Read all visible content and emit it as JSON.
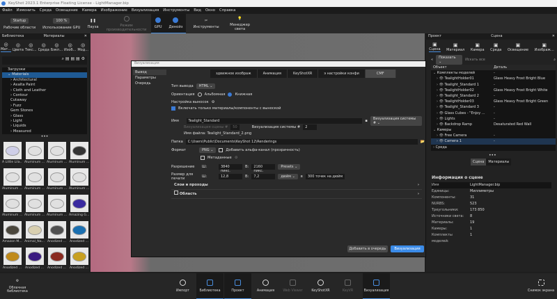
{
  "title": "KeyShot 2023.1 Enterprise Floating License - LightManager.bip",
  "menu": [
    "Файл",
    "Изменить",
    "Среда",
    "Освещение",
    "Камера",
    "Изображение",
    "Визуализация",
    "Инструменты",
    "Вид",
    "Окно",
    "Справка"
  ],
  "toolbar": {
    "workspace_value": "Startup",
    "workspace_label": "Рабочие области",
    "gpu_value": "100 %",
    "gpu_label": "Использование GPU",
    "pause": "Пауза",
    "perf": "Режим производительности",
    "gpu": "GPU",
    "denoise": "Денойз",
    "tools": "Инструменты",
    "light_manager": "Менеджер света"
  },
  "left": {
    "header_left": "Библиотека",
    "header_center": "Материалы",
    "tabs": [
      "Мат...",
      "Цвета",
      "Текс...",
      "Среда",
      "Бэкп...",
      "Изоб...",
      "Мод..."
    ],
    "tree": [
      "Загрузки",
      "Materials",
      "Architectural",
      "Axalta Paint",
      "Cloth and Leather",
      "Contour",
      "Cutaway",
      "Fuzz",
      "Gem Stones",
      "Glass",
      "Light",
      "Liquids",
      "Measured"
    ],
    "thumbs": [
      "A Little Lila...",
      "Aluminum ...",
      "Aluminum ...",
      "Aluminum ...",
      "Aluminum ...",
      "Aluminum ...",
      "Aluminum ...",
      "Aluminum ...",
      "Aluminum ...",
      "Aluminum ...",
      "Aluminum ...",
      "Amazing G...",
      "Amazon M...",
      "Animal_Na...",
      "Anodized ...",
      "Anodized ...",
      "Anodized ...",
      "Anodized ...",
      "Anodized ...",
      "Anodized ..."
    ],
    "thumb_colors": [
      "#cfcfe8",
      "#e0e0e0",
      "#e0e0e0",
      "#333333",
      "#e0e0e0",
      "#e0e0e0",
      "#e0e0e0",
      "#e0e0e0",
      "#e0e0e0",
      "#e0e0e0",
      "#e0e0e0",
      "#3a2aa0",
      "#4a463c",
      "#d8cfb0",
      "#505050",
      "#1a6fb0",
      "#c08a1a",
      "#3a1a80",
      "#8a2a20",
      "#c8a020"
    ]
  },
  "dialog": {
    "title": "Визуализация",
    "nav": [
      "Вывод",
      "Параметры",
      "Очередь"
    ],
    "tabs": [
      "здвижное изображ",
      "Анимация",
      "KeyShotXR",
      "э настройки конфи",
      "CMF"
    ],
    "output_type_label": "Тип вывода",
    "output_type": "HTML",
    "orientation_label": "Ориентация",
    "landscape": "Альбомная",
    "portrait": "Книжная",
    "callout_label": "Настройка выносок",
    "include_only": "Включать только материалы/компоненты с выноской",
    "name_label": "Имя",
    "name_value": "Tealight_Standard",
    "suffix": "Визуализация системы #",
    "scene_render_label": "Визуализация сцены #",
    "scene_render_value": "50",
    "system_render_label": "Визуализация системы #",
    "system_render_value": "2",
    "filename": "Имя файла: Tealight_Standard_2.png",
    "folder_label": "Папка",
    "folder": "C:\\Users\\Public\\Documents\\KeyShot 12\\Renderings",
    "format_label": "Формат",
    "format": "PNG",
    "alpha": "Добавить альфа-канал (прозрачность)",
    "metadata": "Метаданные",
    "resolution_label": "Разрешение",
    "w": "Ш:",
    "h": "В:",
    "res_w": "3840 пикс.",
    "res_h": "2160 пикс.",
    "presets": "Presets",
    "print_label": "Размер для печати",
    "print_w": "12,8",
    "print_h": "7,2",
    "unit": "дюйм",
    "at": "в",
    "dpi": "300 точек на дюйм",
    "layers": "Слои и проходы",
    "region": "Область",
    "queue_btn": "Добавить в очередь",
    "render_btn": "Визуализация"
  },
  "right": {
    "header_left": "Проект",
    "header_center": "Сцена",
    "tabs": [
      "Сцена",
      "Материал",
      "Камера",
      "Среда",
      "Освещение",
      "Изображ..."
    ],
    "show": "Показать",
    "search_placeholder": "Искать все",
    "col_object": "Объект",
    "col_detail": "Деталь",
    "rows": [
      [
        "Комплекты моделей",
        "-"
      ],
      [
        "TealightHolder01",
        "Glass Heavy Frost Bright Blue"
      ],
      [
        "Tealight_Standard 1",
        "-"
      ],
      [
        "TealightHolder02",
        "Glass Heavy Frost Bright White"
      ],
      [
        "Tealight_Standard 2",
        "-"
      ],
      [
        "TealightHolder03",
        "Glass Heavy Frost Bright Green"
      ],
      [
        "Tealight_Standard 3",
        "-"
      ],
      [
        "Glass Cubes - \"Enjoy ...",
        "-"
      ],
      [
        "Lights",
        "-"
      ],
      [
        "Backdrop Ramp",
        "Desaturated Red Wall"
      ],
      [
        "Камеры",
        ""
      ],
      [
        "Free Camera",
        "-"
      ],
      [
        "Camera 1",
        "-"
      ],
      [
        "Среда",
        ""
      ]
    ],
    "bottom_tabs": [
      "Сцена",
      "Материалы"
    ],
    "info_title": "Информация о сцене",
    "info": [
      [
        "Имя",
        "LightManager.bip"
      ],
      [
        "Единицы:",
        "Миллиметры"
      ],
      [
        "Компоненты:",
        "31"
      ],
      [
        "NURBS:",
        "523"
      ],
      [
        "Треугольники:",
        "173 850"
      ],
      [
        "Источники света:",
        "8"
      ],
      [
        "Материалы:",
        "19"
      ],
      [
        "Камеры:",
        "1"
      ],
      [
        "Комплекты моделей:",
        "1"
      ]
    ]
  },
  "bottom": {
    "cloud": "Облачная библиотека",
    "import": "Импорт",
    "library": "Библиотека",
    "project": "Проект",
    "animation": "Анимация",
    "webviewer": "Web Viewer",
    "keyshotxr": "KeyShotXR",
    "keyvr": "KeyVR",
    "render": "Визуализация",
    "screenshot": "Снимок экрана"
  }
}
